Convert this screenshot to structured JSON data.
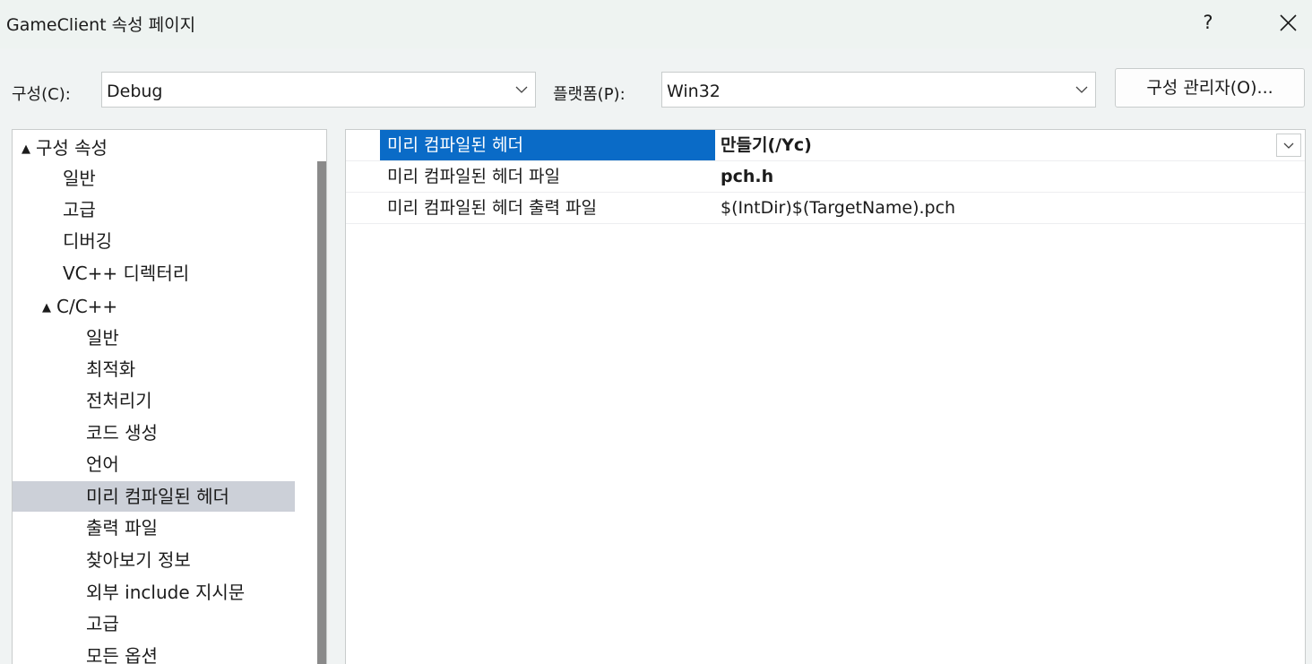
{
  "window": {
    "title": "GameClient 속성 페이지",
    "help_label": "?",
    "close_icon": "close-icon"
  },
  "toolbar": {
    "config_label": "구성(C):",
    "config_value": "Debug",
    "platform_label": "플랫폼(P):",
    "platform_value": "Win32",
    "config_manager_label": "구성 관리자(O)..."
  },
  "tree": {
    "items": [
      {
        "label": "구성 속성",
        "expander": "▲"
      },
      {
        "label": "일반"
      },
      {
        "label": "고급"
      },
      {
        "label": "디버깅"
      },
      {
        "label": "VC++ 디렉터리"
      },
      {
        "label": "C/C++",
        "expander": "▲"
      },
      {
        "label": "일반"
      },
      {
        "label": "최적화"
      },
      {
        "label": "전처리기"
      },
      {
        "label": "코드 생성"
      },
      {
        "label": "언어"
      },
      {
        "label": "미리 컴파일된 헤더",
        "selected": true
      },
      {
        "label": "출력 파일"
      },
      {
        "label": "찾아보기 정보"
      },
      {
        "label": "외부 include 지시문"
      },
      {
        "label": "고급"
      },
      {
        "label": "모든 옵션"
      }
    ]
  },
  "properties": [
    {
      "name": "미리 컴파일된 헤더",
      "value": "만들기(/Yc)"
    },
    {
      "name": "미리 컴파일된 헤더 파일",
      "value": "pch.h"
    },
    {
      "name": "미리 컴파일된 헤더 출력 파일",
      "value": "$(IntDir)$(TargetName).pch"
    }
  ],
  "colors": {
    "selection_blue": "#0a6bc7",
    "tree_selection": "#ccd0d8"
  }
}
